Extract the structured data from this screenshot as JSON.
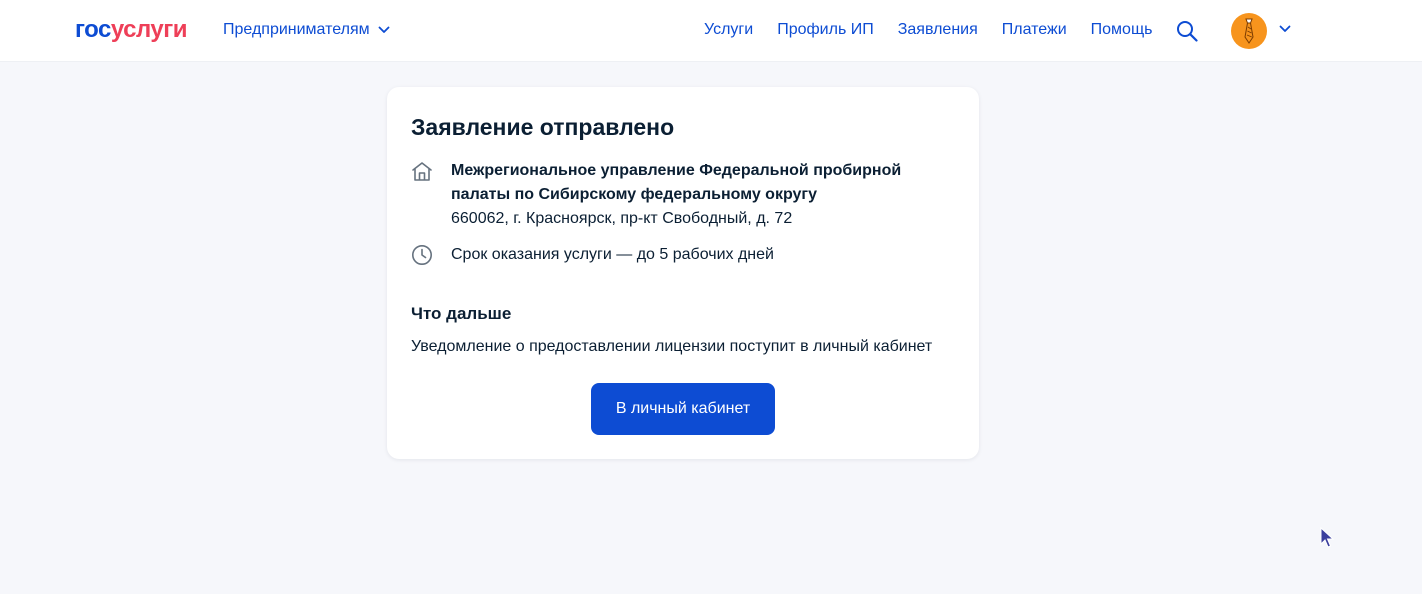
{
  "header": {
    "logo_part1": "гос",
    "logo_part2": "услуги",
    "segment_label": "Предпринимателям",
    "nav": [
      "Услуги",
      "Профиль ИП",
      "Заявления",
      "Платежи",
      "Помощь"
    ],
    "search_icon": "search-icon",
    "avatar_icon": "tie-icon"
  },
  "card": {
    "title": "Заявление отправлено",
    "org_name": "Межрегиональное управление Федеральной пробирной палаты по Сибирскому федеральному округу",
    "org_address": "660062, г. Красноярск, пр-кт Свободный, д. 72",
    "term": "Срок оказания услуги — до 5 рабочих дней",
    "next_title": "Что дальше",
    "next_text": "Уведомление о предоставлении лицензии поступит в личный кабинет",
    "button_label": "В личный кабинет"
  },
  "colors": {
    "brand_blue": "#0d4cd3",
    "brand_red": "#ee3f58",
    "avatar_orange": "#f7941d",
    "background": "#f6f7fb"
  }
}
